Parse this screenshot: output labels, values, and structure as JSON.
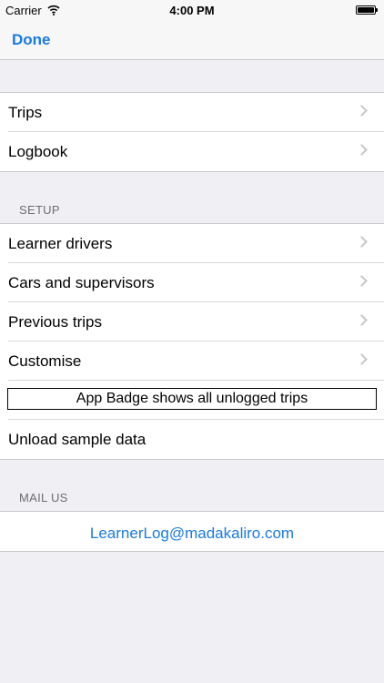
{
  "status_bar": {
    "carrier": "Carrier",
    "time": "4:00 PM"
  },
  "nav": {
    "done_label": "Done"
  },
  "group1": {
    "items": [
      "Trips",
      "Logbook"
    ]
  },
  "setup": {
    "header": "SETUP",
    "items": [
      "Learner drivers",
      "Cars and supervisors",
      "Previous trips",
      "Customise"
    ],
    "badge_label": "App Badge shows all unlogged trips",
    "unload_label": "Unload sample data"
  },
  "mail": {
    "header": "MAIL US",
    "email": "LearnerLog@madakaliro.com"
  },
  "colors": {
    "accent": "#1a7ae3",
    "background": "#efeff4"
  },
  "icons": [
    "wifi-icon",
    "battery-icon",
    "chevron-right-icon"
  ]
}
